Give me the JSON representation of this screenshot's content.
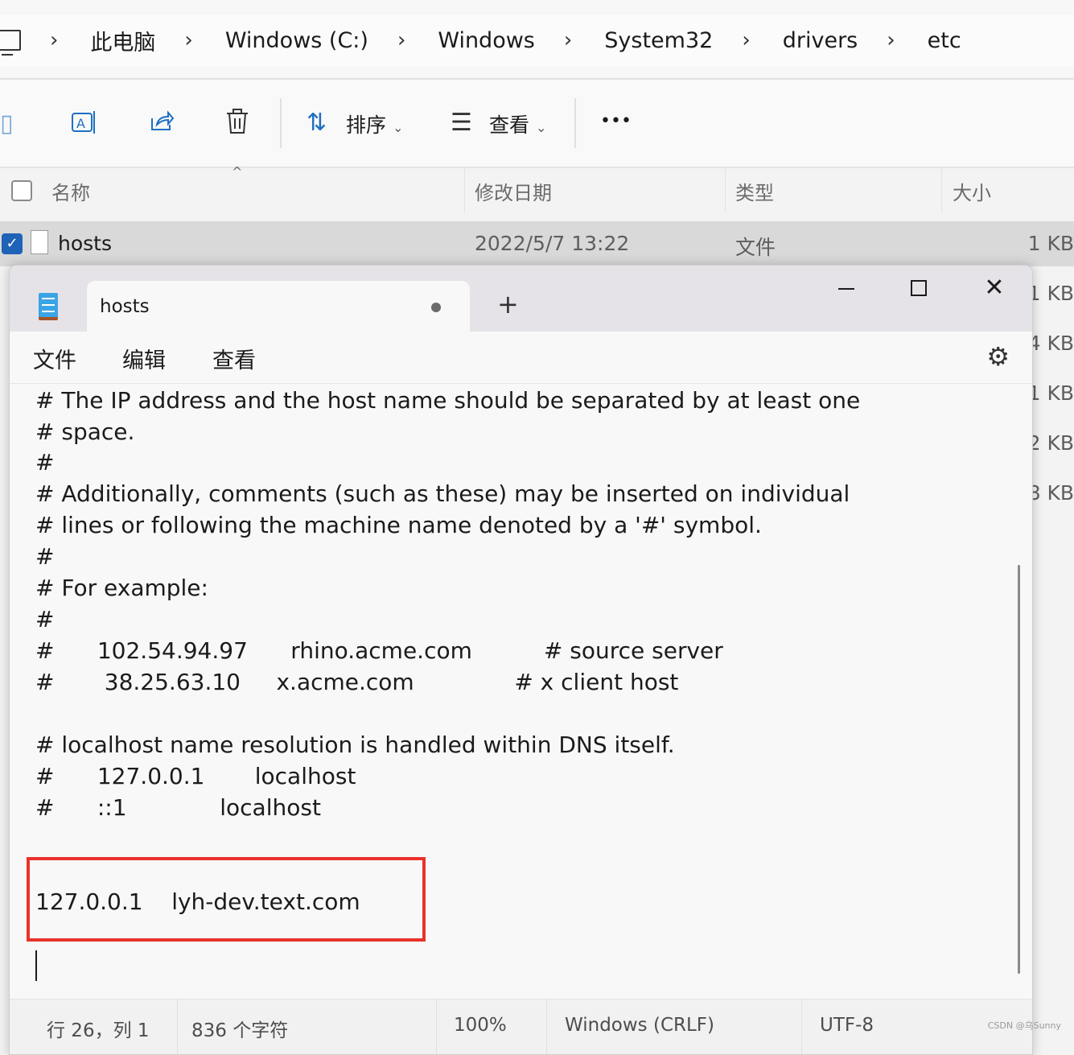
{
  "explorer": {
    "breadcrumb": [
      "此电脑",
      "Windows (C:)",
      "Windows",
      "System32",
      "drivers",
      "etc"
    ],
    "toolbar": {
      "sort_label": "排序",
      "view_label": "查看",
      "more_label": "•••"
    },
    "columns": {
      "name": "名称",
      "modified": "修改日期",
      "type": "类型",
      "size": "大小"
    },
    "selected_file": {
      "name": "hosts",
      "modified": "2022/5/7 13:22",
      "type": "文件",
      "size": "1 KB"
    },
    "other_sizes": [
      "1 KB",
      "4 KB",
      "1 KB",
      "2 KB",
      "8 KB"
    ]
  },
  "notepad": {
    "tab_title": "hosts",
    "new_tab": "+",
    "menu": [
      "文件",
      "编辑",
      "查看"
    ],
    "lines": [
      "# The IP address and the host name should be separated by at least one",
      "# space.",
      "#",
      "# Additionally, comments (such as these) may be inserted on individual",
      "# lines or following the machine name denoted by a '#' symbol.",
      "#",
      "# For example:",
      "#",
      "#      102.54.94.97      rhino.acme.com          # source server",
      "#       38.25.63.10     x.acme.com              # x client host",
      "",
      "# localhost name resolution is handled within DNS itself.",
      "#      127.0.0.1       localhost",
      "#      ::1             localhost",
      "",
      "",
      "127.0.0.1    lyh-dev.text.com"
    ],
    "status": {
      "position": "行 26，列 1",
      "chars": "836 个字符",
      "zoom": "100%",
      "line_ending": "Windows (CRLF)",
      "encoding": "UTF-8"
    }
  },
  "watermark": "CSDN @乌Sunny"
}
